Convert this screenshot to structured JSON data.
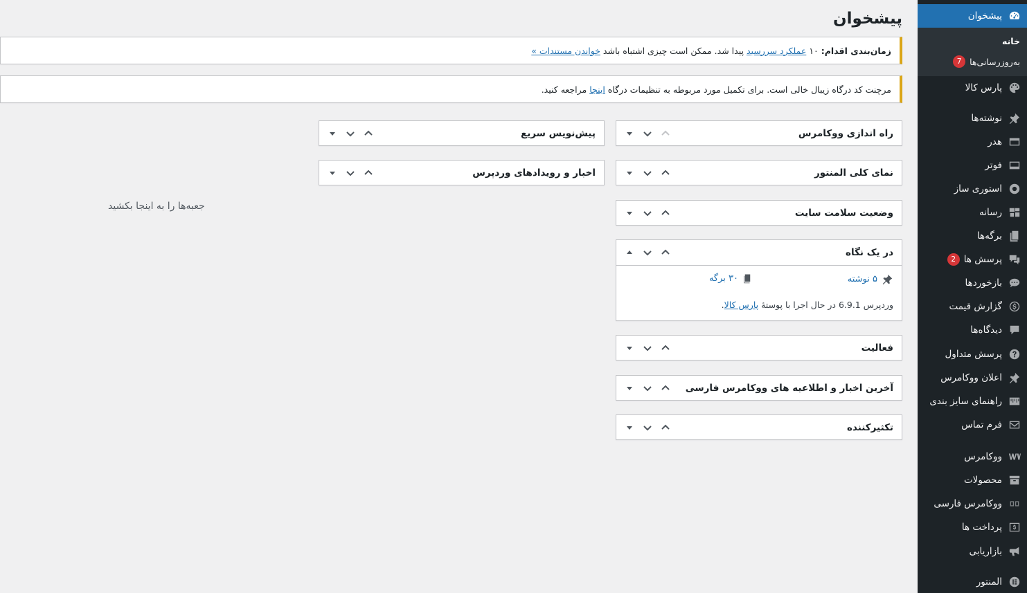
{
  "page": {
    "title": "پیشخوان"
  },
  "sidebar": {
    "dashboard": "پیشخوان",
    "submenu": {
      "home": "خانه",
      "updates": "به‌روزرسانی‌ها",
      "updates_count": "7"
    },
    "items": [
      {
        "label": "پارس کالا",
        "icon": "palette-icon"
      },
      {
        "label": "نوشته‌ها",
        "icon": "pin-icon"
      },
      {
        "label": "هدر",
        "icon": "header-icon"
      },
      {
        "label": "فوتر",
        "icon": "footer-icon"
      },
      {
        "label": "استوری ساز",
        "icon": "story-icon"
      },
      {
        "label": "رسانه",
        "icon": "media-icon"
      },
      {
        "label": "برگه‌ها",
        "icon": "pages-icon"
      },
      {
        "label": "پرسش ها",
        "icon": "questions-icon",
        "badge": "2"
      },
      {
        "label": "بازخوردها",
        "icon": "feedback-icon"
      },
      {
        "label": "گزارش قیمت",
        "icon": "dollar-icon"
      },
      {
        "label": "دیدگاه‌ها",
        "icon": "comments-icon"
      },
      {
        "label": "پرسش متداول",
        "icon": "help-icon"
      },
      {
        "label": "اعلان ووکامرس",
        "icon": "pin-icon"
      },
      {
        "label": "راهنمای سایز بندی",
        "icon": "ruler-icon"
      },
      {
        "label": "فرم تماس",
        "icon": "mail-icon"
      },
      {
        "label": "ووکامرس",
        "icon": "woo-icon"
      },
      {
        "label": "محصولات",
        "icon": "archive-icon"
      },
      {
        "label": "ووکامرس فارسی",
        "icon": "woo-fa-icon"
      },
      {
        "label": "پرداخت ها",
        "icon": "payment-icon"
      },
      {
        "label": "بازاریابی",
        "icon": "megaphone-icon"
      },
      {
        "label": "المنتور",
        "icon": "elementor-icon"
      }
    ]
  },
  "notices": {
    "cron": {
      "label": "زمان‌بندی اقدام:",
      "count": "۱۰",
      "link1": "عملکرد سررسید",
      "middle": "پیدا شد. ممکن است چیزی اشتباه باشد",
      "link2": "خواندن مستندات »"
    },
    "gateway": {
      "text": "مرچنت کد درگاه زیبال خالی است. برای تکمیل مورد مربوطه به تنظیمات درگاه",
      "link": "اینجا",
      "end": "مراجعه کنید."
    }
  },
  "widgets": {
    "woo_setup": "راه اندازی ووکامرس",
    "elementor_overview": "نمای کلی المنتور",
    "site_health": "وضعیت سلامت سایت",
    "at_a_glance": "در یک نگاه",
    "glance_posts": "۵ نوشته",
    "glance_pages": "۳۰ برگه",
    "glance_footer": "وردپرس 6.9.1 در حال اجرا با پوستهٔ",
    "glance_theme": "پارس کالا",
    "activity": "فعالیت",
    "woo_fa_news": "آخرین اخبار و اطلاعیه های ووکامرس فارسی",
    "duplicator": "تکثیرکننده",
    "quick_draft": "پیش‌نویس سریع",
    "wp_events": "اخبار و رویدادهای وردپرس"
  },
  "drop_zone": "جعبه‌ها را به اینجا بکشید",
  "colors": {
    "sidebar_bg": "#1d2327",
    "accent": "#2271b1",
    "notice_warning": "#dba617",
    "badge": "#d63638"
  }
}
